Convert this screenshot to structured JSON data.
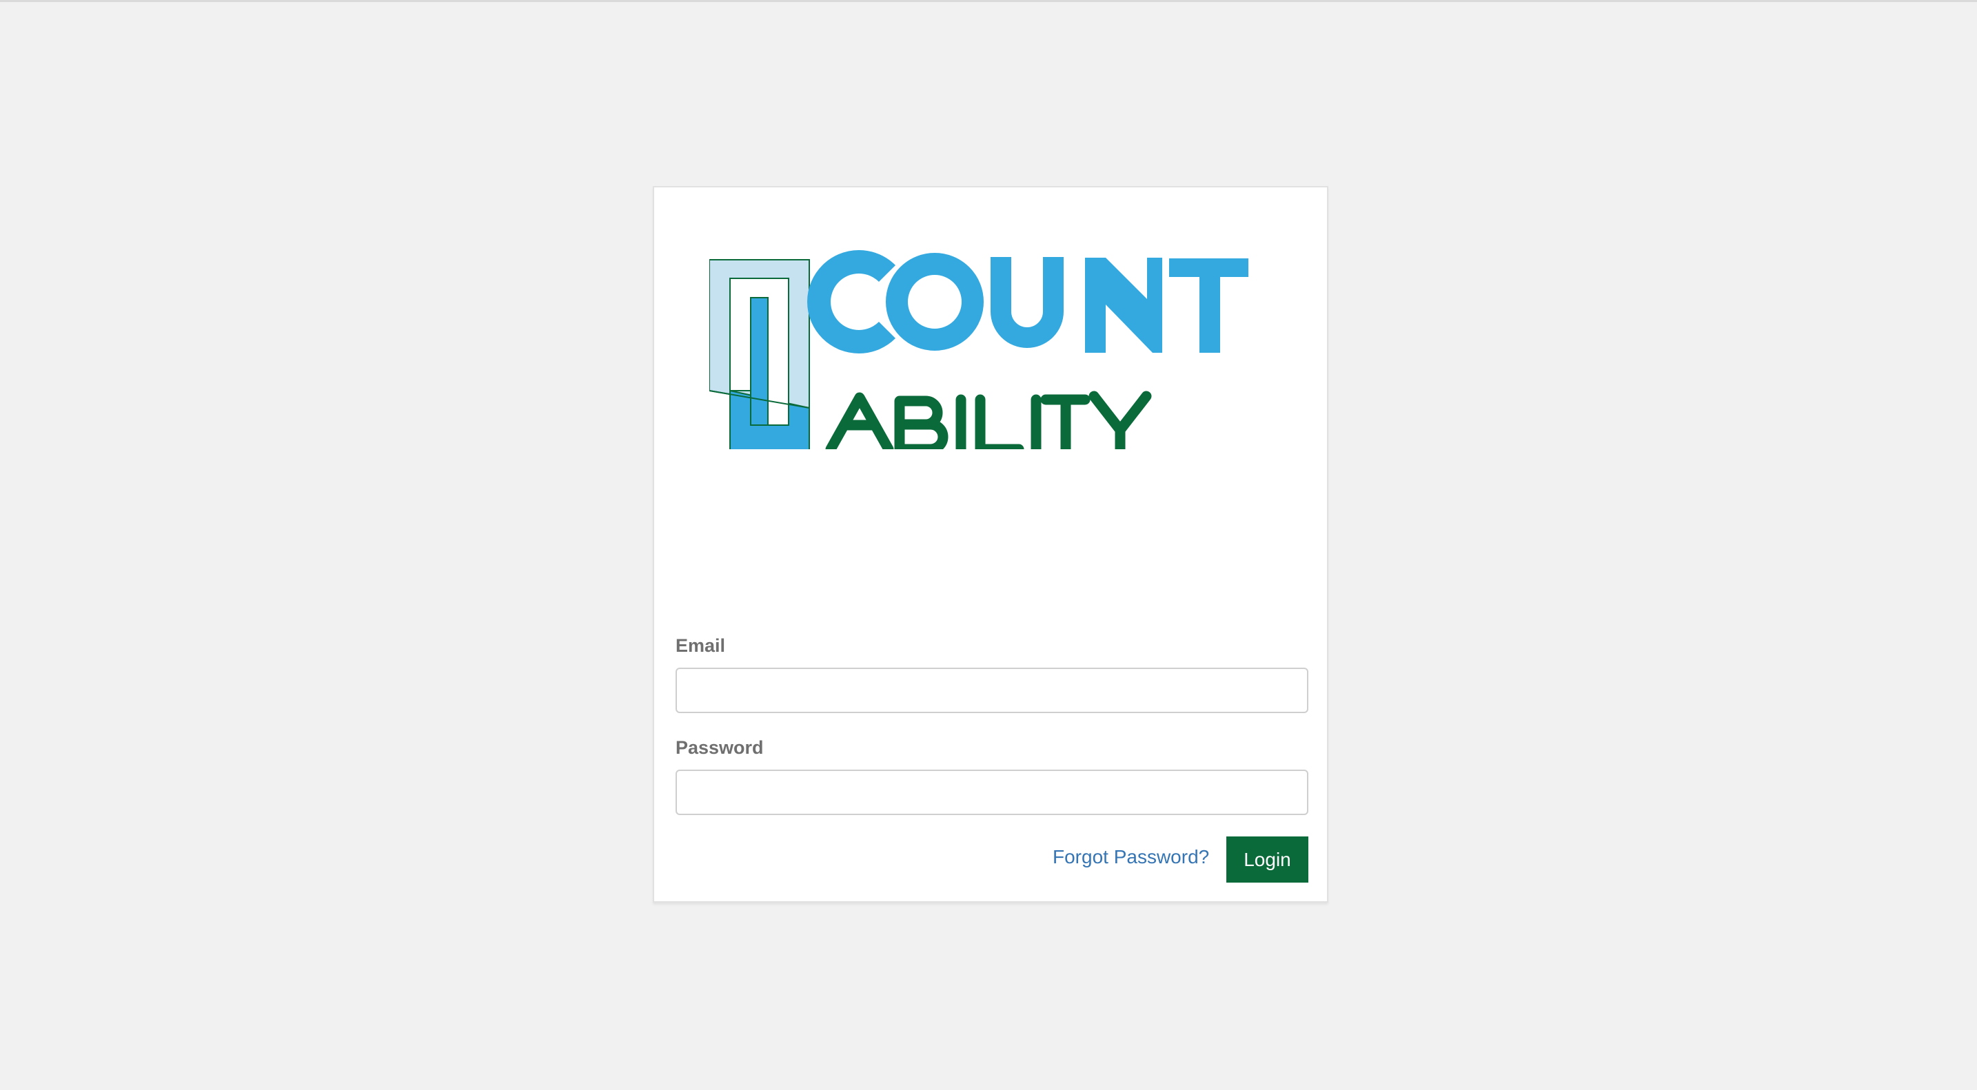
{
  "logo": {
    "name": "COUNTABILITY",
    "line1": "COUNT",
    "line2": "ABILITY",
    "colors": {
      "blue": "#33a9e0",
      "light_blue": "#c6e1ef",
      "green": "#0a6a3a"
    }
  },
  "form": {
    "email_label": "Email",
    "email_value": "",
    "password_label": "Password",
    "password_value": "",
    "forgot_label": "Forgot Password?",
    "login_label": "Login"
  },
  "colors": {
    "page_background": "#f1f1f1",
    "card_background": "#ffffff",
    "label": "#6f6f6f",
    "link": "#3675b4",
    "button": "#0a6a3a"
  }
}
